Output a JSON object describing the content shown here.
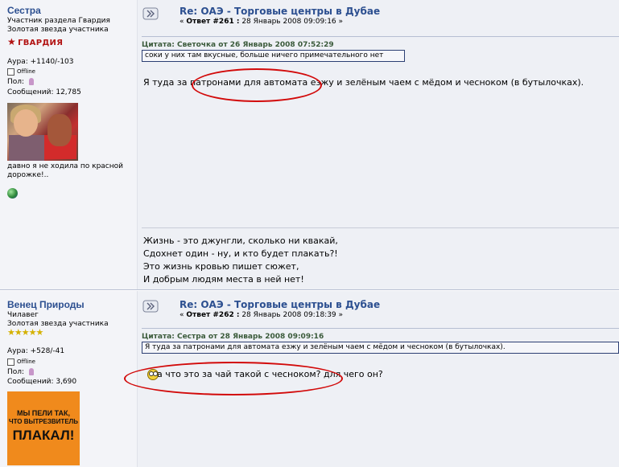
{
  "post1": {
    "username": "Сестра",
    "role": "Участник раздела Гвардия",
    "rank": "Золотая звезда участника",
    "badge": "ГВАРДИЯ",
    "aura": "Аура: +1140/-103",
    "status": "Offline",
    "gender_label": "Пол:",
    "messages": "Сообщений: 12,785",
    "side_signature": "давно я не ходила по красной дорожке!..",
    "title": "Re: ОАЭ - Торговые центры в Дубае",
    "reply_prefix": "« ",
    "reply_num": "Ответ #261 :",
    "reply_date": " 28 Январь 2008 09:09:16 »",
    "quote_header": "Цитата: Светочка от 26 Январь 2008 07:52:29",
    "quote_text": "соки у них там вкусные, больше ничего примечательного нет",
    "body": "Я туда за патронами для автомата езжу и зелёным чаем с мёдом и чесноком (в бутылочках).",
    "signature": [
      "Жизнь - это джунгли, сколько ни квакай,",
      "Сдохнет один - ну, и кто будет плакать?!",
      "Это жизнь кровью пишет сюжет,",
      "И добрым людям места в ней нет!"
    ]
  },
  "post2": {
    "username": "Венец Природы",
    "role": "Чилавег",
    "rank": "Золотая звезда участника",
    "stars": "★★★★★",
    "aura": "Аура: +528/-41",
    "status": "Offline",
    "gender_label": "Пол:",
    "messages": "Сообщений: 3,690",
    "avatar_lines": [
      "МЫ ПЕЛИ ТАК,",
      "ЧТО ВЫТРЕЗВИТЕЛЬ",
      "ПЛАКАЛ!"
    ],
    "title": "Re: ОАЭ - Торговые центры в Дубае",
    "reply_prefix": "« ",
    "reply_num": "Ответ #262 :",
    "reply_date": " 28 Январь 2008 09:18:39 »",
    "quote_header": "Цитата: Сестра от 28 Январь 2008 09:09:16",
    "quote_text": "Я туда за патронами для автомата езжу и зелёным чаем с мёдом и чесноком (в бутылочках).",
    "body": "а что это за чай такой с чесноком? для чего он?"
  },
  "colors": {
    "username": "#2c4f90",
    "highlight_ellipse": "#d20a0a",
    "post_background": "#eef0f5"
  }
}
